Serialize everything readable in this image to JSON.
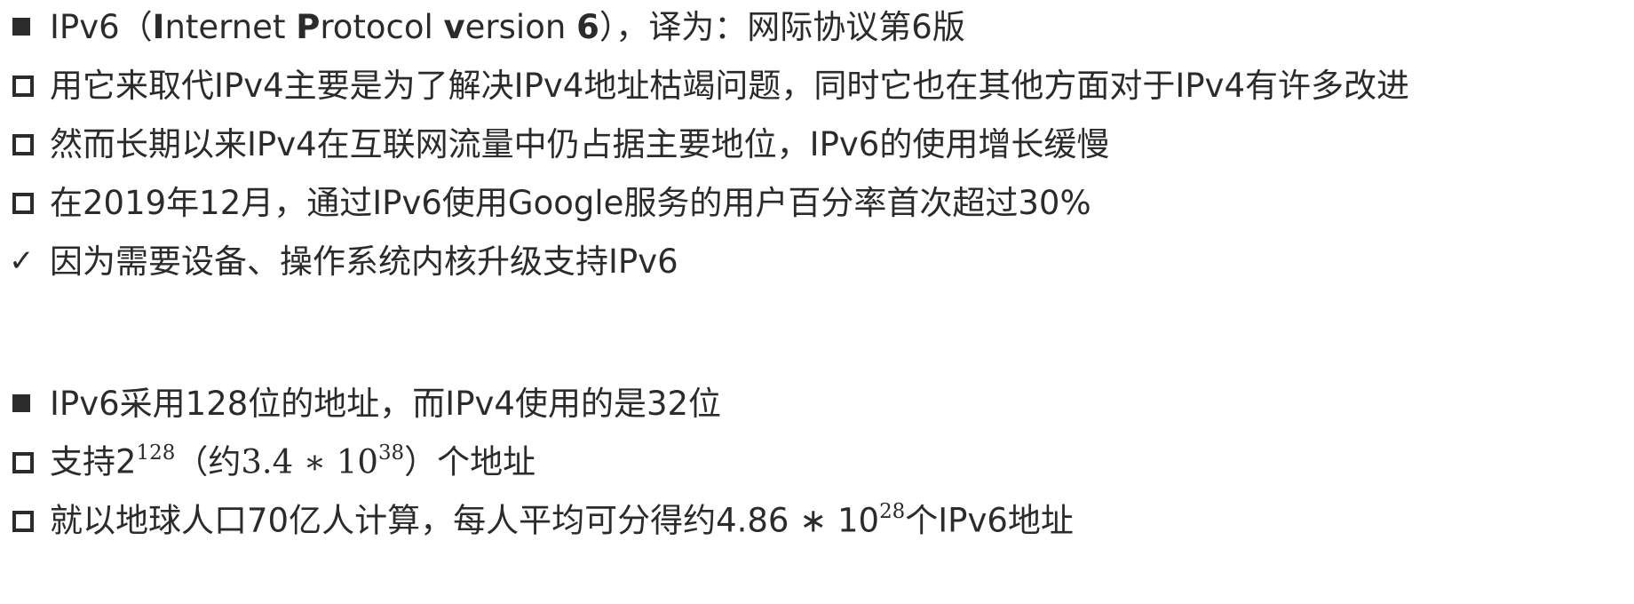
{
  "block1": {
    "heading": {
      "pre": "IPv6（",
      "I": "I",
      "nternet": "nternet ",
      "P": "P",
      "rotocol": "rotocol ",
      "v": "v",
      "ersion": "ersion ",
      "six": "6",
      "post": "），译为：网际协议第6版"
    },
    "items": [
      "用它来取代IPv4主要是为了解决IPv4地址枯竭问题，同时它也在其他方面对于IPv4有许多改进",
      "然而长期以来IPv4在互联网流量中仍占据主要地位，IPv6的使用增长缓慢",
      "在2019年12月，通过IPv6使用Google服务的用户百分率首次超过30%"
    ],
    "check": "因为需要设备、操作系统内核升级支持IPv6",
    "check_icon": "✓"
  },
  "block2": {
    "heading": "IPv6采用128位的地址，而IPv4使用的是32位",
    "item1": {
      "pre": "支持2",
      "exp": "128",
      "mid": "（约3.4 ∗ 10",
      "exp2": "38",
      "post": "）个地址"
    },
    "item2": {
      "pre": "就以地球人口70亿人计算，每人平均可分得约4.86 ∗ 10",
      "exp": "28",
      "post": "个IPv6地址"
    }
  },
  "colors": {
    "text": "#2b2b2b",
    "background": "#ffffff"
  }
}
